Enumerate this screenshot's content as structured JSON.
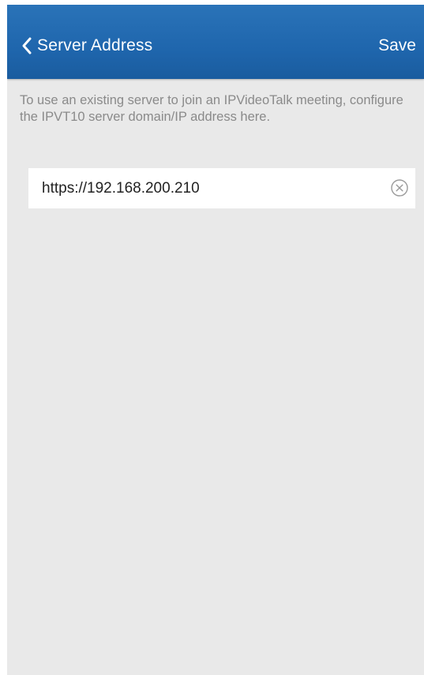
{
  "header": {
    "back_icon": "chevron-left-icon",
    "title": "Server Address",
    "save_label": "Save"
  },
  "description": "To use an existing server to join an IPVideoTalk meeting, configure the IPVT10 server domain/IP address here.",
  "server_address": {
    "value": "https://192.168.200.210",
    "clear_icon": "clear-circle-icon"
  },
  "colors": {
    "app_bar": "#2a73b8",
    "background": "#e9e9e9",
    "description_text": "#8a8a8a"
  }
}
